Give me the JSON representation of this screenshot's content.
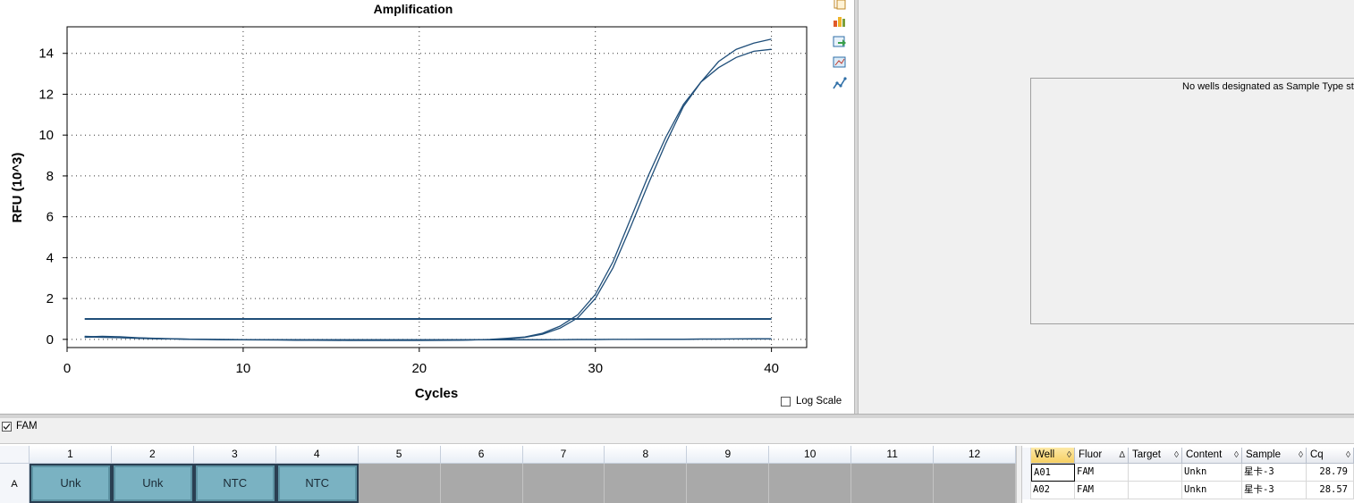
{
  "chart": {
    "title": "Amplification",
    "ylabel": "RFU (10^3)",
    "xlabel": "Cycles",
    "log_scale_label": "Log Scale",
    "log_scale_checked": false
  },
  "chart_data": {
    "type": "line",
    "title": "Amplification",
    "xlabel": "Cycles",
    "ylabel": "RFU (10^3)",
    "xlim": [
      0,
      42
    ],
    "ylim": [
      -0.4,
      15.3
    ],
    "xticks": [
      0,
      10,
      20,
      30,
      40
    ],
    "yticks": [
      0,
      2,
      4,
      6,
      8,
      10,
      12,
      14
    ],
    "grid": true,
    "line_color": "#1f4e79",
    "threshold": 1.0,
    "x": [
      1,
      2,
      3,
      4,
      5,
      6,
      7,
      8,
      9,
      10,
      11,
      12,
      13,
      14,
      15,
      16,
      17,
      18,
      19,
      20,
      21,
      22,
      23,
      24,
      25,
      26,
      27,
      28,
      29,
      30,
      31,
      32,
      33,
      34,
      35,
      36,
      37,
      38,
      39,
      40
    ],
    "series": [
      {
        "values": [
          0.12,
          0.15,
          0.13,
          0.08,
          0.05,
          0.03,
          0.01,
          0.0,
          -0.01,
          -0.02,
          -0.02,
          -0.03,
          -0.03,
          -0.04,
          -0.04,
          -0.05,
          -0.05,
          -0.05,
          -0.05,
          -0.05,
          -0.04,
          -0.04,
          -0.03,
          0.0,
          0.05,
          0.12,
          0.3,
          0.65,
          1.2,
          2.2,
          3.8,
          5.9,
          8.0,
          9.9,
          11.5,
          12.6,
          13.6,
          14.2,
          14.5,
          14.7
        ]
      },
      {
        "values": [
          0.1,
          0.13,
          0.11,
          0.07,
          0.04,
          0.02,
          0.0,
          -0.01,
          -0.02,
          -0.02,
          -0.03,
          -0.03,
          -0.04,
          -0.04,
          -0.05,
          -0.05,
          -0.05,
          -0.05,
          -0.05,
          -0.05,
          -0.05,
          -0.04,
          -0.03,
          -0.01,
          0.03,
          0.1,
          0.25,
          0.55,
          1.05,
          2.0,
          3.5,
          5.5,
          7.6,
          9.6,
          11.4,
          12.6,
          13.3,
          13.8,
          14.1,
          14.2
        ]
      },
      {
        "values": [
          0.15,
          0.12,
          0.09,
          0.06,
          0.04,
          0.02,
          0.01,
          0.0,
          -0.01,
          -0.01,
          -0.01,
          -0.02,
          -0.02,
          -0.02,
          -0.02,
          -0.02,
          -0.02,
          -0.02,
          -0.02,
          -0.02,
          -0.02,
          -0.02,
          -0.02,
          -0.02,
          -0.02,
          -0.02,
          -0.02,
          -0.01,
          -0.01,
          -0.01,
          0.0,
          0.0,
          0.0,
          0.0,
          0.0,
          0.01,
          0.01,
          0.02,
          0.02,
          0.03
        ]
      },
      {
        "values": [
          0.13,
          0.1,
          0.08,
          0.05,
          0.03,
          0.02,
          0.01,
          0.0,
          0.0,
          -0.01,
          -0.01,
          -0.01,
          -0.02,
          -0.02,
          -0.02,
          -0.02,
          -0.02,
          -0.02,
          -0.02,
          -0.02,
          -0.02,
          -0.02,
          -0.02,
          -0.02,
          -0.01,
          -0.01,
          -0.01,
          -0.01,
          0.0,
          0.0,
          0.0,
          0.0,
          0.01,
          0.01,
          0.01,
          0.02,
          0.02,
          0.02,
          0.03,
          0.03
        ]
      }
    ]
  },
  "right_panel": {
    "message": "No wells designated as Sample Type sta"
  },
  "fluor": {
    "label": "FAM",
    "checked": true
  },
  "plate": {
    "columns": [
      "1",
      "2",
      "3",
      "4",
      "5",
      "6",
      "7",
      "8",
      "9",
      "10",
      "11",
      "12"
    ],
    "rows": [
      {
        "label": "A",
        "wells": [
          "Unk",
          "Unk",
          "NTC",
          "NTC",
          "",
          "",
          "",
          "",
          "",
          "",
          "",
          ""
        ]
      }
    ]
  },
  "table": {
    "headers": [
      "Well",
      "Fluor",
      "Target",
      "Content",
      "Sample",
      "Cq"
    ],
    "rows": [
      [
        "A01",
        "FAM",
        "",
        "Unkn",
        "星卡-3",
        "28.79"
      ],
      [
        "A02",
        "FAM",
        "",
        "Unkn",
        "星卡-3",
        "28.57"
      ]
    ]
  }
}
